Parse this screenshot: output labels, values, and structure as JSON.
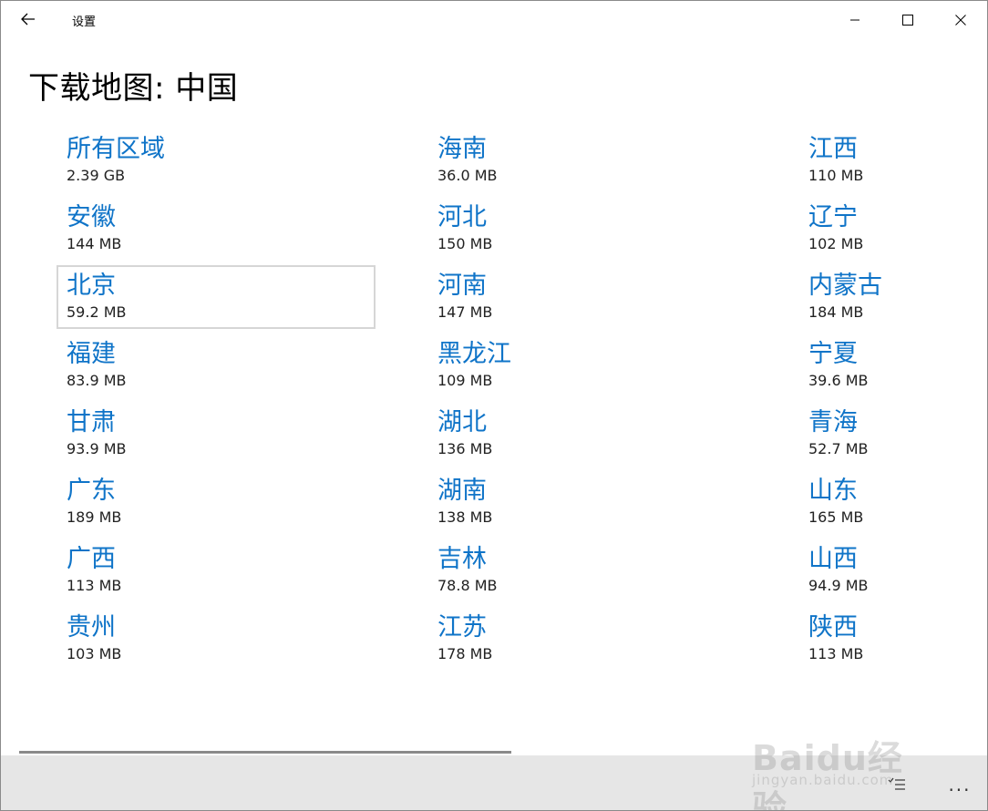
{
  "window": {
    "app_title": "设置",
    "page_title": "下载地图: 中国"
  },
  "regions": {
    "col1": [
      {
        "name": "所有区域",
        "size": "2.39 GB"
      },
      {
        "name": "安徽",
        "size": "144 MB"
      },
      {
        "name": "北京",
        "size": "59.2 MB"
      },
      {
        "name": "福建",
        "size": "83.9 MB"
      },
      {
        "name": "甘肃",
        "size": "93.9 MB"
      },
      {
        "name": "广东",
        "size": "189 MB"
      },
      {
        "name": "广西",
        "size": "113 MB"
      },
      {
        "name": "贵州",
        "size": "103 MB"
      }
    ],
    "col2": [
      {
        "name": "海南",
        "size": "36.0 MB"
      },
      {
        "name": "河北",
        "size": "150 MB"
      },
      {
        "name": "河南",
        "size": "147 MB"
      },
      {
        "name": "黑龙江",
        "size": "109 MB"
      },
      {
        "name": "湖北",
        "size": "136 MB"
      },
      {
        "name": "湖南",
        "size": "138 MB"
      },
      {
        "name": "吉林",
        "size": "78.8 MB"
      },
      {
        "name": "江苏",
        "size": "178 MB"
      }
    ],
    "col3": [
      {
        "name": "江西",
        "size": "110 MB"
      },
      {
        "name": "辽宁",
        "size": "102 MB"
      },
      {
        "name": "内蒙古",
        "size": "184 MB"
      },
      {
        "name": "宁夏",
        "size": "39.6 MB"
      },
      {
        "name": "青海",
        "size": "52.7 MB"
      },
      {
        "name": "山东",
        "size": "165 MB"
      },
      {
        "name": "山西",
        "size": "94.9 MB"
      },
      {
        "name": "陕西",
        "size": "113 MB"
      }
    ]
  },
  "focused_item": "北京",
  "bottom_bar": {
    "more_label": "..."
  },
  "watermark": {
    "logo_text": "Baidu经验",
    "url": "jingyan.baidu.com"
  },
  "colors": {
    "accent": "#0f74c8",
    "bottom_bar": "#e6e6e6"
  }
}
